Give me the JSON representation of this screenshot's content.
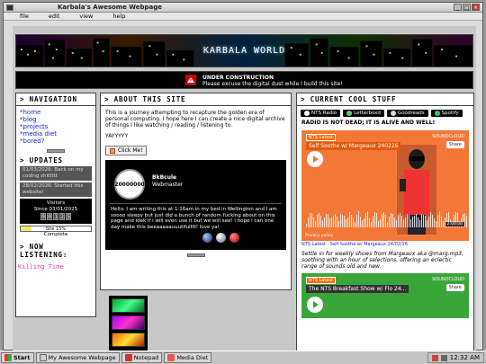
{
  "window": {
    "title": "Karbala's Awesome Webpage",
    "menu": [
      "file",
      "edit",
      "view",
      "help"
    ]
  },
  "header": {
    "title": "KARBALA WORLD"
  },
  "construction": {
    "title": "UNDER CONSTRUCTION",
    "message": "Please excuse the digital dust while I build this site!"
  },
  "navigation": {
    "title": "> NAVIGATION",
    "items": [
      "*home",
      "*blog",
      "*projects",
      "*media diet",
      "*bored?"
    ]
  },
  "updates": {
    "title": "> UPDATES",
    "items": [
      "01/03/2026: Back on my coding shittttt",
      "28/02/2026: Started this website!"
    ]
  },
  "visitors": {
    "label": "Visitors",
    "since": "Since 03/01/2025",
    "digits": [
      "0",
      "0",
      "1",
      "2",
      "5"
    ]
  },
  "progress": {
    "label": "Site 15%",
    "value": 0.15,
    "complete": "Complete"
  },
  "listening": {
    "title": "> NOW LISTENING:",
    "track": "Killing Time"
  },
  "about": {
    "title": "> ABOUT THIS SITE",
    "paragraph": "This is a journey attempting to recapture the golden era of personal computing. I hope here I can create a nice digital archive of things I like watching / reading / listening to.",
    "yay": "YAYYYYY",
    "button": "Click Me!"
  },
  "profile": {
    "avatar_text": "20000000",
    "name": "BkBcule",
    "role": "Webmaster",
    "bio": "Hello. I am writing this at 1:16am in my bed in Wellington and I am soooo sleepy but just did a bunch of random fucking about on this page and idek if i will even use it but we will see! i hope i can one day make this beeaaaaauuutifulllll! love ya!"
  },
  "current": {
    "title": "> CURRENT COOL STUFF",
    "tabs": [
      "NTS Radio",
      "Letterboxd",
      "Goodreads",
      "Spotify"
    ],
    "headline": "RADIO IS NOT DEAD; IT IS ALIVE AND WELL!",
    "player1": {
      "link": "NTS Latest",
      "title": "Self Soothe w/ Margeaux 240226",
      "source": "SOUNDCLOUD",
      "share": "Share",
      "duration": "2:00:00",
      "privacy": "Privacy policy",
      "caption": "NTS Latest · Self Soothe w/ Margeaux 24/02/26"
    },
    "description": "Settle in for weekly shows from Margeaux aka @marg.mp3, soothing with an hour of selections, offering an eclectic range of sounds old and new.",
    "player2": {
      "link": "NTS Latest",
      "title": "The NTS Breakfast Show w/ Flo 24...",
      "source": "SOUNDCLOUD",
      "share": "Share"
    }
  },
  "taskbar": {
    "start": "Start",
    "apps": [
      "My Awesome Webpage",
      "Notepad",
      "Media Diet"
    ],
    "time": "12:32 AM"
  },
  "colors": {
    "accent": "#f37838",
    "nav_link": "#2222cc",
    "listening": "#dd44aa"
  }
}
